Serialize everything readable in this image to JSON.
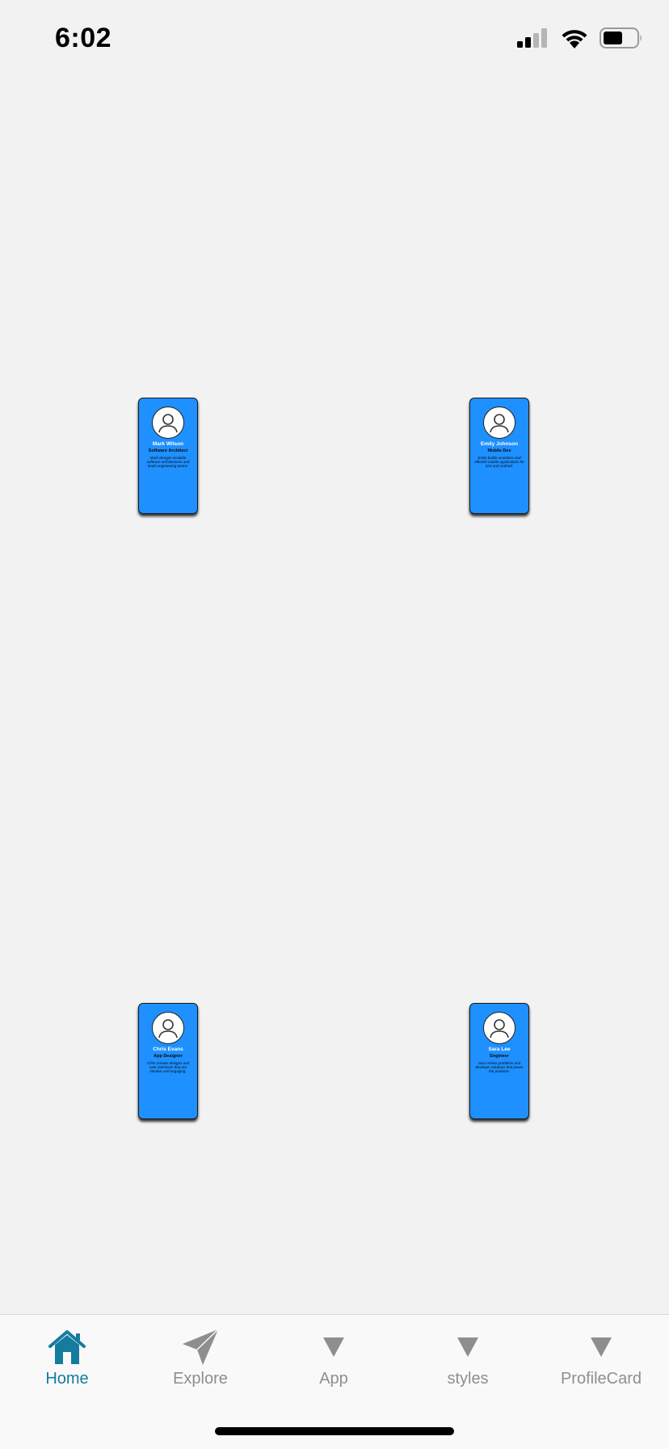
{
  "status_bar": {
    "time": "6:02"
  },
  "cards": [
    {
      "name": "Mark Wilson",
      "title": "Software Architect",
      "description": "Mark designs scalable software architectures and leads engineering teams."
    },
    {
      "name": "Emily Johnson",
      "title": "Mobile Dev",
      "description": "Emily builds seamless and efficient mobile applications for iOS and Android."
    },
    {
      "name": "Chris Evans",
      "title": "App Designer",
      "description": "Chris creates designs and user interfaces that are intuitive and engaging."
    },
    {
      "name": "Sara Lee",
      "title": "Engineer",
      "description": "Sara solves problems and develops solutions that power the products."
    }
  ],
  "tab_bar": {
    "active": "Home",
    "tabs": [
      {
        "label": "Home",
        "icon": "home-icon"
      },
      {
        "label": "Explore",
        "icon": "paper-plane-icon"
      },
      {
        "label": "App",
        "icon": "triangle-down-icon"
      },
      {
        "label": "styles",
        "icon": "triangle-down-icon"
      },
      {
        "label": "ProfileCard",
        "icon": "triangle-down-icon"
      }
    ]
  },
  "colors": {
    "background": "#f2f2f2",
    "card": "#1e90ff",
    "active_tab": "#157c9e",
    "inactive_tab": "#8e8e8e"
  }
}
